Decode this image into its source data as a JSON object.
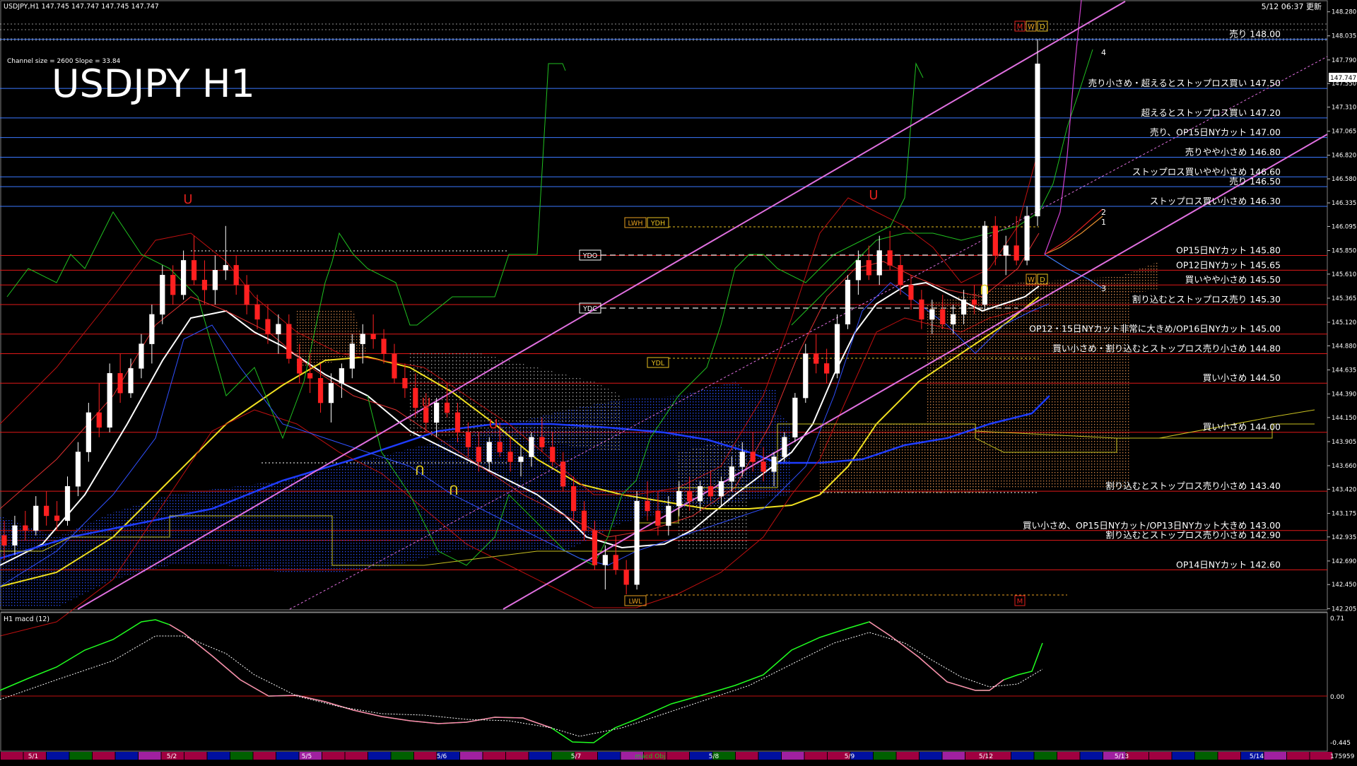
{
  "header": {
    "symbol_info": "USDJPY,H1  147.745 147.747 147.745 147.747",
    "updated": "5/12 06:37 更新",
    "channel_info": "Channel size = 2600  Slope = 33.84",
    "big_title": "USDJPY H1",
    "current_price": "147.747"
  },
  "timeframe_markers": [
    "M",
    "W",
    "D"
  ],
  "level_tags": {
    "lwh": "LWH",
    "ydh": "YDH",
    "ydo": "YDO",
    "ydc": "YDC",
    "ydl": "YDL",
    "lwl": "LWL",
    "w": "W",
    "d": "D",
    "m": "M"
  },
  "macd_panel": {
    "label": "H1  macd (12)",
    "top_value": "0.71",
    "zero_value": "0.00",
    "bottom_value": "-0.445",
    "bottom_right": "175959",
    "indicator_tag": "macd Obj"
  },
  "projection_labels": [
    "4",
    "2",
    "1",
    "3"
  ],
  "chart_data": {
    "type": "candlestick",
    "title": "USDJPY H1",
    "ylim": [
      142.2,
      148.4
    ],
    "y_ticks": [
      148.28,
      148.035,
      147.79,
      147.55,
      147.31,
      147.065,
      146.82,
      146.58,
      146.335,
      146.095,
      145.85,
      145.61,
      145.365,
      145.12,
      144.88,
      144.635,
      144.39,
      144.15,
      143.905,
      143.66,
      143.42,
      143.175,
      142.935,
      142.69,
      142.45,
      142.205
    ],
    "x_dates": [
      {
        "label": "5/1",
        "x": 0.5
      },
      {
        "label": "5/2",
        "x": 20.5
      },
      {
        "label": "5/5",
        "x": 44.5
      },
      {
        "label": "5/6",
        "x": 64.5
      },
      {
        "label": "5/7",
        "x": 84.5
      },
      {
        "label": "5/8",
        "x": 104.5
      },
      {
        "label": "5/9",
        "x": 124.5
      },
      {
        "label": "5/12",
        "x": 144.5
      },
      {
        "label": "5/13",
        "x": 164.5
      },
      {
        "label": "5/14",
        "x": 184.5
      }
    ],
    "x_range": [
      -4,
      192
    ],
    "levels": [
      {
        "price": 148.0,
        "label": "売り 148.00",
        "color": "#3a78ff"
      },
      {
        "price": 147.5,
        "label": "売り小さめ・超えるとストップロス買い 147.50",
        "color": "#3a78ff"
      },
      {
        "price": 147.2,
        "label": "超えるとストップロス買い 147.20",
        "color": "#3a78ff"
      },
      {
        "price": 147.0,
        "label": "売り、OP15日NYカット 147.00",
        "color": "#3a78ff"
      },
      {
        "price": 146.8,
        "label": "売りやや小さめ 146.80",
        "color": "#3a78ff"
      },
      {
        "price": 146.6,
        "label": "ストップロス買いやや小さめ 146.60",
        "color": "#3a78ff"
      },
      {
        "price": 146.5,
        "label": "売り 146.50",
        "color": "#3a78ff"
      },
      {
        "price": 146.3,
        "label": "ストップロス買い小さめ 146.30",
        "color": "#3a78ff"
      },
      {
        "price": 145.8,
        "label": "OP15日NYカット 145.80",
        "color": "#e01818"
      },
      {
        "price": 145.65,
        "label": "OP12日NYカット 145.65",
        "color": "#e01818"
      },
      {
        "price": 145.5,
        "label": "買いやや小さめ 145.50",
        "color": "#e01818"
      },
      {
        "price": 145.3,
        "label": "割り込むとストップロス売り 145.30",
        "color": "#e01818"
      },
      {
        "price": 145.0,
        "label": "OP12・15日NYカット非常に大きめ/OP16日NYカット 145.00",
        "color": "#e01818"
      },
      {
        "price": 144.8,
        "label": "買い小さめ・割り込むとストップロス売り小さめ 144.80",
        "color": "#e01818"
      },
      {
        "price": 144.5,
        "label": "買い小さめ 144.50",
        "color": "#e01818"
      },
      {
        "price": 144.0,
        "label": "買い小さめ 144.00",
        "color": "#e01818"
      },
      {
        "price": 143.4,
        "label": "割り込むとストップロス売り小さめ 143.40",
        "color": "#e01818"
      },
      {
        "price": 143.0,
        "label": "買い小さめ、OP15日NYカット/OP13日NYカット大きめ 143.00",
        "color": "#e01818"
      },
      {
        "price": 142.9,
        "label": "割り込むとストップロス売り小さめ 142.90",
        "color": "#e01818"
      },
      {
        "price": 142.6,
        "label": "OP14日NYカット 142.60",
        "color": "#e01818"
      }
    ],
    "series": [
      {
        "type": "candle",
        "ohlc": [
          [
            142.95,
            143.1,
            142.7,
            142.85
          ],
          [
            142.85,
            143.15,
            142.75,
            143.05
          ],
          [
            143.05,
            143.2,
            142.9,
            143.0
          ],
          [
            143.0,
            143.35,
            142.95,
            143.25
          ],
          [
            143.25,
            143.4,
            143.05,
            143.15
          ],
          [
            143.15,
            143.3,
            143.0,
            143.1
          ],
          [
            143.1,
            143.55,
            143.05,
            143.45
          ],
          [
            143.45,
            143.9,
            143.35,
            143.8
          ],
          [
            143.8,
            144.3,
            143.7,
            144.2
          ],
          [
            144.2,
            144.5,
            143.95,
            144.05
          ],
          [
            144.05,
            144.7,
            144.0,
            144.6
          ],
          [
            144.6,
            144.8,
            144.3,
            144.4
          ],
          [
            144.4,
            144.75,
            144.35,
            144.65
          ],
          [
            144.65,
            145.0,
            144.55,
            144.9
          ],
          [
            144.9,
            145.3,
            144.7,
            145.2
          ],
          [
            145.2,
            145.7,
            145.1,
            145.6
          ],
          [
            145.6,
            145.7,
            145.3,
            145.4
          ],
          [
            145.4,
            145.85,
            145.35,
            145.75
          ],
          [
            145.75,
            146.0,
            145.5,
            145.55
          ],
          [
            145.55,
            145.75,
            145.3,
            145.45
          ],
          [
            145.45,
            145.8,
            145.3,
            145.65
          ],
          [
            145.65,
            146.1,
            145.55,
            145.7
          ],
          [
            145.7,
            145.8,
            145.4,
            145.5
          ],
          [
            145.5,
            145.6,
            145.2,
            145.3
          ],
          [
            145.3,
            145.4,
            145.05,
            145.15
          ],
          [
            145.15,
            145.3,
            144.9,
            145.0
          ],
          [
            145.0,
            145.2,
            144.8,
            145.1
          ],
          [
            145.1,
            145.2,
            144.7,
            144.75
          ],
          [
            144.75,
            144.9,
            144.5,
            144.6
          ],
          [
            144.6,
            144.8,
            144.4,
            144.55
          ],
          [
            144.55,
            144.7,
            144.2,
            144.3
          ],
          [
            144.3,
            144.6,
            144.1,
            144.5
          ],
          [
            144.5,
            144.7,
            144.35,
            144.65
          ],
          [
            144.65,
            145.0,
            144.55,
            144.9
          ],
          [
            144.9,
            145.1,
            144.7,
            145.0
          ],
          [
            145.0,
            145.2,
            144.85,
            144.95
          ],
          [
            144.95,
            145.05,
            144.7,
            144.8
          ],
          [
            144.8,
            144.9,
            144.5,
            144.55
          ],
          [
            144.55,
            144.7,
            144.35,
            144.45
          ],
          [
            144.45,
            144.6,
            144.15,
            144.25
          ],
          [
            144.25,
            144.4,
            144.0,
            144.1
          ],
          [
            144.1,
            144.35,
            143.95,
            144.3
          ],
          [
            144.3,
            144.5,
            144.15,
            144.2
          ],
          [
            144.2,
            144.3,
            143.9,
            144.0
          ],
          [
            144.0,
            144.1,
            143.75,
            143.85
          ],
          [
            143.85,
            144.0,
            143.6,
            143.7
          ],
          [
            143.7,
            143.95,
            143.6,
            143.9
          ],
          [
            143.9,
            144.1,
            143.75,
            143.8
          ],
          [
            143.8,
            143.95,
            143.6,
            143.7
          ],
          [
            143.7,
            143.85,
            143.55,
            143.75
          ],
          [
            143.75,
            144.0,
            143.65,
            143.95
          ],
          [
            143.95,
            144.15,
            143.8,
            143.85
          ],
          [
            143.85,
            144.0,
            143.65,
            143.7
          ],
          [
            143.7,
            143.8,
            143.4,
            143.45
          ],
          [
            143.45,
            143.55,
            143.1,
            143.2
          ],
          [
            143.2,
            143.3,
            142.9,
            143.0
          ],
          [
            143.0,
            143.1,
            142.6,
            142.65
          ],
          [
            142.65,
            142.85,
            142.4,
            142.75
          ],
          [
            142.75,
            142.95,
            142.55,
            142.6
          ],
          [
            142.6,
            142.7,
            142.35,
            142.45
          ],
          [
            142.45,
            143.4,
            142.4,
            143.3
          ],
          [
            143.3,
            143.5,
            143.1,
            143.2
          ],
          [
            143.2,
            143.4,
            142.95,
            143.05
          ],
          [
            143.05,
            143.35,
            142.95,
            143.25
          ],
          [
            143.25,
            143.5,
            143.15,
            143.4
          ],
          [
            143.4,
            143.55,
            143.2,
            143.3
          ],
          [
            143.3,
            143.5,
            143.2,
            143.45
          ],
          [
            143.45,
            143.6,
            143.3,
            143.35
          ],
          [
            143.35,
            143.55,
            143.25,
            143.5
          ],
          [
            143.5,
            143.75,
            143.4,
            143.65
          ],
          [
            143.65,
            143.9,
            143.55,
            143.8
          ],
          [
            143.8,
            144.0,
            143.6,
            143.7
          ],
          [
            143.7,
            143.85,
            143.5,
            143.6
          ],
          [
            143.6,
            143.8,
            143.45,
            143.75
          ],
          [
            143.75,
            144.0,
            143.7,
            143.95
          ],
          [
            143.95,
            144.4,
            143.9,
            144.35
          ],
          [
            144.35,
            144.9,
            144.3,
            144.8
          ],
          [
            144.8,
            145.0,
            144.6,
            144.7
          ],
          [
            144.7,
            144.85,
            144.5,
            144.6
          ],
          [
            144.6,
            145.2,
            144.55,
            145.1
          ],
          [
            145.1,
            145.6,
            145.05,
            145.55
          ],
          [
            145.55,
            145.85,
            145.4,
            145.75
          ],
          [
            145.75,
            145.9,
            145.55,
            145.6
          ],
          [
            145.6,
            146.0,
            145.5,
            145.85
          ],
          [
            145.85,
            146.05,
            145.65,
            145.7
          ],
          [
            145.7,
            145.8,
            145.4,
            145.5
          ],
          [
            145.5,
            145.6,
            145.25,
            145.35
          ],
          [
            145.35,
            145.45,
            145.05,
            145.15
          ],
          [
            145.15,
            145.35,
            145.0,
            145.25
          ],
          [
            145.25,
            145.4,
            145.05,
            145.1
          ],
          [
            145.1,
            145.3,
            145.0,
            145.2
          ],
          [
            145.2,
            145.45,
            145.1,
            145.35
          ],
          [
            145.35,
            145.5,
            145.2,
            145.3
          ],
          [
            145.3,
            146.15,
            145.25,
            146.1
          ],
          [
            146.1,
            146.2,
            145.7,
            145.8
          ],
          [
            145.8,
            146.0,
            145.6,
            145.9
          ],
          [
            145.9,
            146.2,
            145.7,
            145.75
          ],
          [
            145.75,
            146.3,
            145.7,
            146.2
          ],
          [
            146.2,
            148.0,
            146.1,
            147.75
          ]
        ]
      }
    ]
  }
}
